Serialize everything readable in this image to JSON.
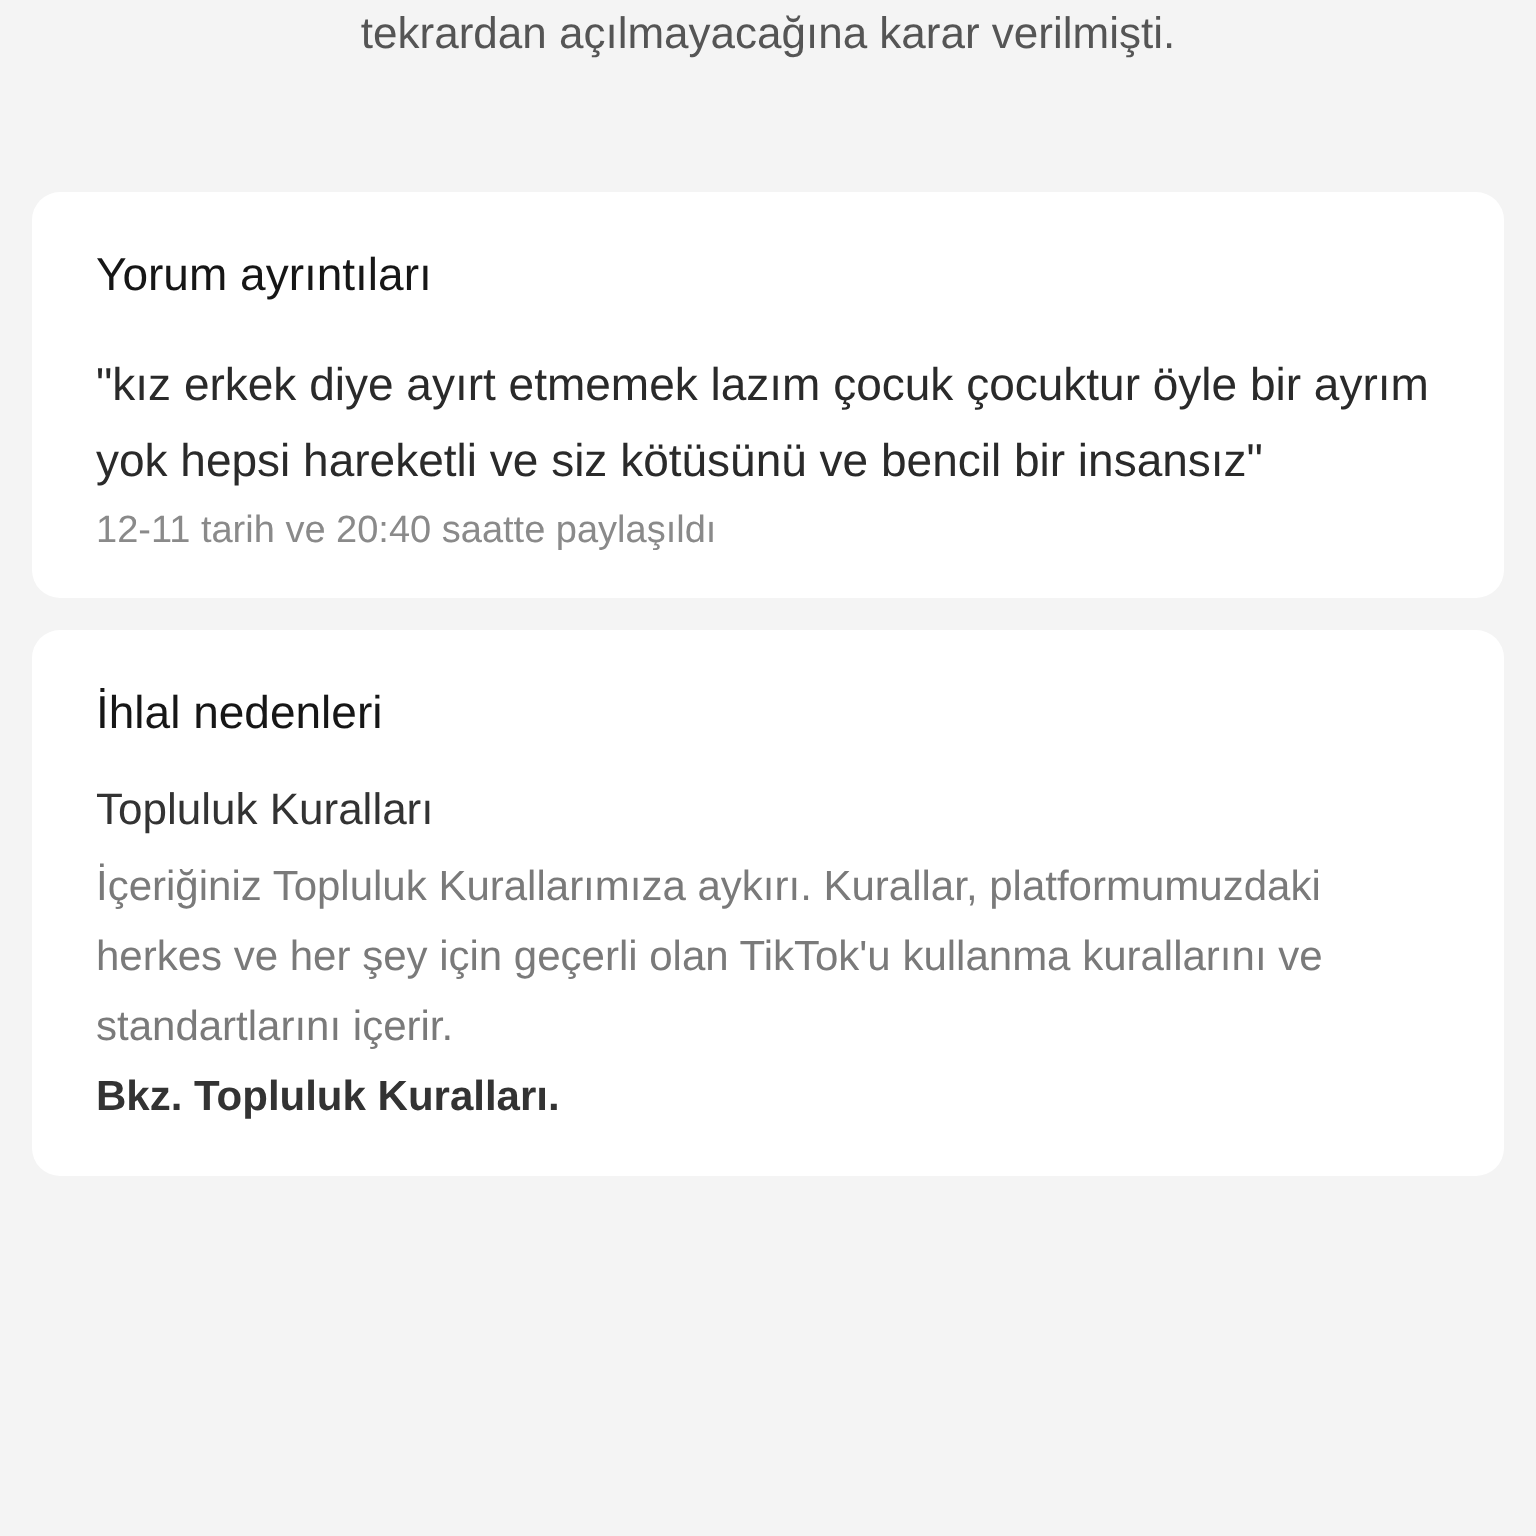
{
  "intro_text": "tekrardan açılmayacağına karar verilmişti.",
  "comment_details": {
    "title": "Yorum ayrıntıları",
    "quote": "\"kız erkek diye ayırt etmemek lazım çocuk çocuktur öyle bir ayrım yok hepsi hareketli ve siz kötüsünü ve bencil bir insansız\"",
    "meta": "12-11 tarih ve 20:40 saatte paylaşıldı"
  },
  "violation_reasons": {
    "title": "İhlal nedenleri",
    "reason_title": "Topluluk Kuralları",
    "description": "İçeriğiniz Topluluk Kurallarımıza aykırı. Kurallar, platformumuzdaki herkes ve her şey için geçerli olan TikTok'u kullanma kurallarını ve standartlarını içerir.",
    "link": "Bkz. Topluluk Kuralları."
  }
}
